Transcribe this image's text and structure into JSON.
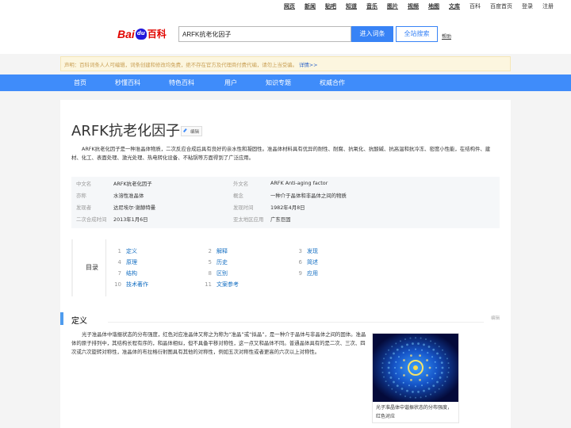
{
  "topnav": {
    "links": [
      {
        "label": "网页",
        "bold": true
      },
      {
        "label": "新闻",
        "bold": true
      },
      {
        "label": "贴吧",
        "bold": true
      },
      {
        "label": "知道",
        "bold": true
      },
      {
        "label": "音乐",
        "bold": true
      },
      {
        "label": "图片",
        "bold": true
      },
      {
        "label": "视频",
        "bold": true
      },
      {
        "label": "地图",
        "bold": true
      },
      {
        "label": "文库",
        "bold": true
      },
      {
        "label": "百科",
        "bold": false
      },
      {
        "label": "百度首页",
        "bold": false
      },
      {
        "label": "登录",
        "bold": false
      },
      {
        "label": "注册",
        "bold": false
      }
    ]
  },
  "header": {
    "logo_text_bai": "Bai",
    "logo_text_du": "du",
    "logo_text_ke": "百科",
    "search_value": "ARFK抗老化因子",
    "enter_label": "进入词条",
    "site_search_label": "全站搜索",
    "help_label": "帮助"
  },
  "notice": {
    "text": "声明：百科词条人人可编辑，词条创建和修改均免费，绝不存在官方及代理商付费代编，请勿上当受骗。",
    "detail": "详情>>"
  },
  "mainnav": {
    "items": [
      "首页",
      "秒懂百科",
      "特色百科",
      "用户",
      "知识专题",
      "权威合作"
    ]
  },
  "article": {
    "title": "ARFK抗老化因子",
    "edit_label": "编辑",
    "summary": "ARFK抗老化因子是一种准晶体物质，二次反应合成后具有良好的亲水性和凝固性。准晶体材料具有优异的耐性、耐腐、抗氧化、抗酸碱、抗高温和抗冷冻、密度小性能，在结构件、建材、化工、表面处理、激光处理、热电转化设备、不粘锅等方面得到了广泛应用。",
    "info": [
      {
        "k": "中文名",
        "v": "ARFK抗老化因子"
      },
      {
        "k": "外文名",
        "v": "ARFK Anti-aging factor"
      },
      {
        "k": "亦称",
        "v": "水溶性准晶体"
      },
      {
        "k": "概念",
        "v": "一种介于晶体和非晶体之间的物质"
      },
      {
        "k": "发现者",
        "v": "达尼埃尔·谢赫特曼"
      },
      {
        "k": "发现时间",
        "v": "1982年4月8日"
      },
      {
        "k": "二次合成时间",
        "v": "2013年1月6日"
      },
      {
        "k": "亚太地区应用",
        "v": "广东巨固"
      }
    ],
    "toc_label": "目录",
    "toc": [
      {
        "num": "1",
        "label": "定义"
      },
      {
        "num": "2",
        "label": "解释"
      },
      {
        "num": "3",
        "label": "发现"
      },
      {
        "num": "4",
        "label": "原理"
      },
      {
        "num": "5",
        "label": "历史"
      },
      {
        "num": "6",
        "label": "简述"
      },
      {
        "num": "7",
        "label": "结构"
      },
      {
        "num": "8",
        "label": "区别"
      },
      {
        "num": "9",
        "label": "应用"
      },
      {
        "num": "10",
        "label": "技术著作"
      },
      {
        "num": "11",
        "label": "文案参考"
      }
    ],
    "section_title": "定义",
    "section_edit": "编辑",
    "section_text": "光子准晶体中谐振状态的分布强度，红色对应准晶体又称之为称为“准晶”或“拟晶”，是一种介于晶体与非晶体之间的固体。准晶体的原子排列中，其结构长程有序的，和晶体相似，但不具备平移对称性，这一点又和晶体不同。普通晶体具有的是二次、三次、四次或六次旋转对称性，准晶体的布拉格衍射图具有其他的对称性，例如五次对称性或者更高的六次以上对称性。",
    "figure_caption": "光子准晶体中谐振状态的分布强度，红色对应"
  }
}
